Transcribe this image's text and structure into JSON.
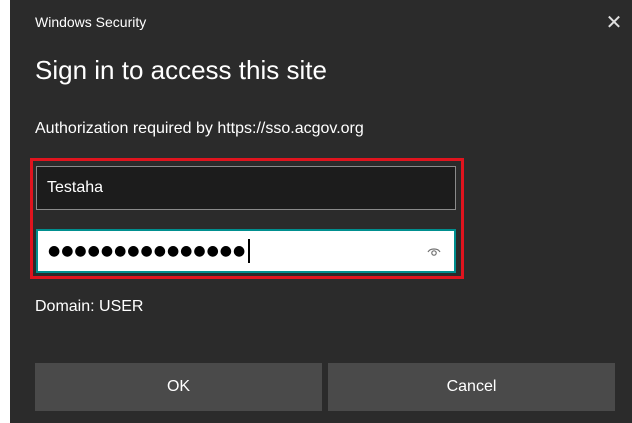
{
  "window": {
    "app_title": "Windows Security",
    "close_glyph": "✕"
  },
  "dialog": {
    "heading": "Sign in to access this site",
    "message": "Authorization required by https://sso.acgov.org",
    "domain": "Domain: USER"
  },
  "form": {
    "username_value": "Testaha",
    "password_masked": "●●●●●●●●●●●●●●●",
    "reveal_icon": "eye-icon"
  },
  "buttons": {
    "ok_label": "OK",
    "cancel_label": "Cancel"
  },
  "colors": {
    "background": "#2b2b2b",
    "highlight_border": "#e0141e",
    "focus_border": "#008f8f",
    "button": "#4a4a4a"
  }
}
